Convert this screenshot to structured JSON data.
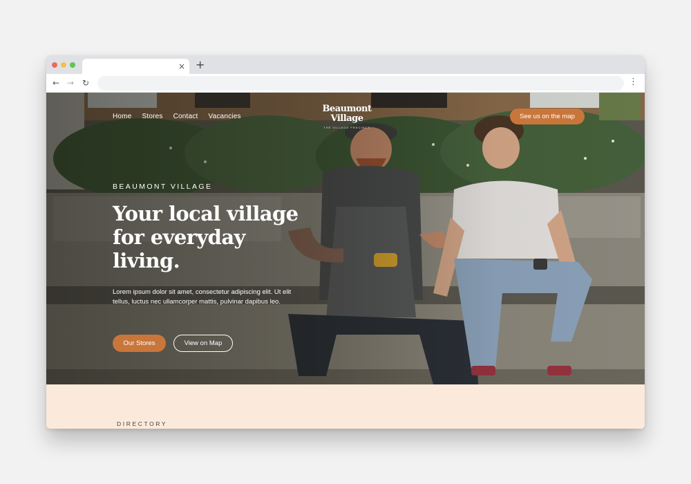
{
  "browser": {
    "tab_close": "×",
    "new_tab": "+",
    "back": "←",
    "forward": "→",
    "reload": "↻",
    "menu": "⋮"
  },
  "site": {
    "nav": [
      "Home",
      "Stores",
      "Contact",
      "Vacancies"
    ],
    "logo": {
      "line1": "Beaumont",
      "line2": "Village",
      "tagline": "THE VILLAGE PRECINCT"
    },
    "cta_map": "See us on the map"
  },
  "hero": {
    "eyebrow": "BEAUMONT VILLAGE",
    "headline": "Your local village for everyday living.",
    "body": "Lorem ipsum dolor sit amet, consectetur adipiscing elit. Ut elit tellus, luctus nec ullamcorper mattis, pulvinar dapibus leo.",
    "primary_button": "Our Stores",
    "secondary_button": "View on Map"
  },
  "directory": {
    "label": "DIRECTORY"
  },
  "colors": {
    "accent": "#c9763b",
    "directory_bg": "#fbeadb",
    "page_bg": "#f2f2f2"
  }
}
